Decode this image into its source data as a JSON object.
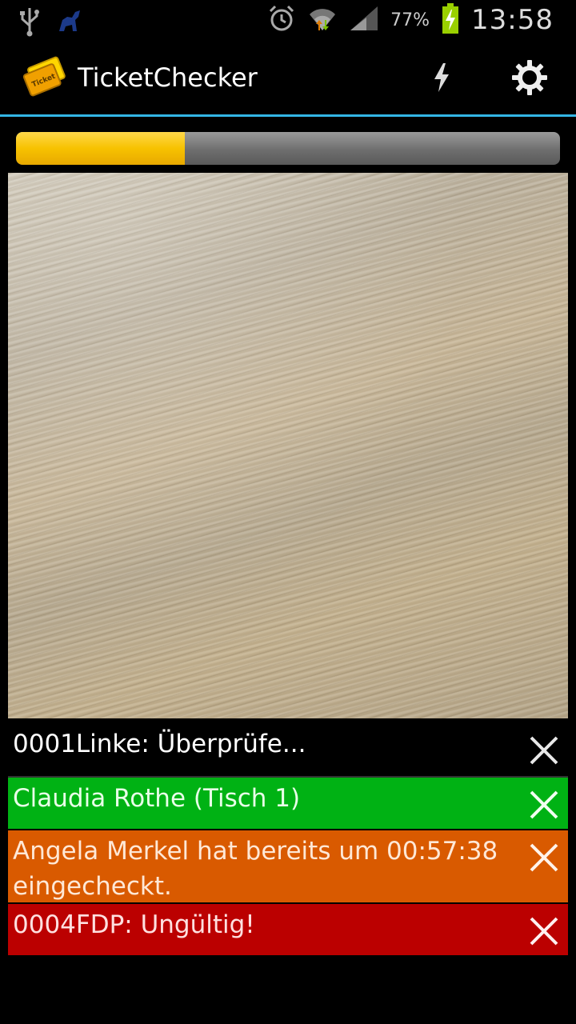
{
  "status_bar": {
    "icons": [
      "usb-icon",
      "android-debug-icon",
      "alarm-icon",
      "wifi-icon",
      "signal-icon",
      "battery-charging-icon"
    ],
    "battery_percent": "77%",
    "time": "13:58"
  },
  "action_bar": {
    "title": "TicketChecker",
    "actions": [
      "flash-icon",
      "settings-gear-icon"
    ]
  },
  "scan_progress": 0.31,
  "colors": {
    "accent_line": "#33b5e5",
    "progress_fill": "#f7c200",
    "ok": "#00b214",
    "warning": "#d95a00",
    "error": "#bb0000"
  },
  "results": [
    {
      "text": "0001Linke: Überprüfe...",
      "status": "checking"
    },
    {
      "text": "Claudia Rothe (Tisch 1)",
      "status": "valid"
    },
    {
      "text": "Angela Merkel hat bereits um 00:57:38 eingecheckt.",
      "status": "already-checked-in"
    },
    {
      "text": "0004FDP: Ungültig!",
      "status": "invalid"
    }
  ]
}
